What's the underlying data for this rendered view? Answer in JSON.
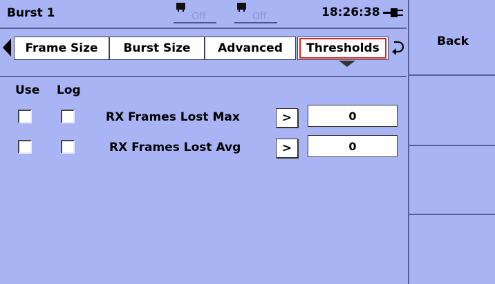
{
  "header": {
    "title": "Burst 1",
    "ports": [
      {
        "icon": "port-icon",
        "status": "Off"
      },
      {
        "icon": "port-icon",
        "status": "Off"
      }
    ],
    "clock": "18:26:38",
    "power_icon": "ac-plug-icon"
  },
  "tabs": [
    {
      "label": "Frame Size"
    },
    {
      "label": "Burst Size"
    },
    {
      "label": "Advanced"
    },
    {
      "label": "Thresholds",
      "active": true
    }
  ],
  "columns": {
    "use": "Use",
    "log": "Log"
  },
  "rows": [
    {
      "label": "RX Frames Lost Max",
      "button": ">",
      "value": "0"
    },
    {
      "label": "RX Frames Lost Avg",
      "button": ">",
      "value": "0"
    }
  ],
  "softkeys": {
    "back": "Back"
  },
  "colors": {
    "background": "#a8b4f4",
    "divider": "#56609a",
    "active_tab_outline": "#e02020"
  }
}
